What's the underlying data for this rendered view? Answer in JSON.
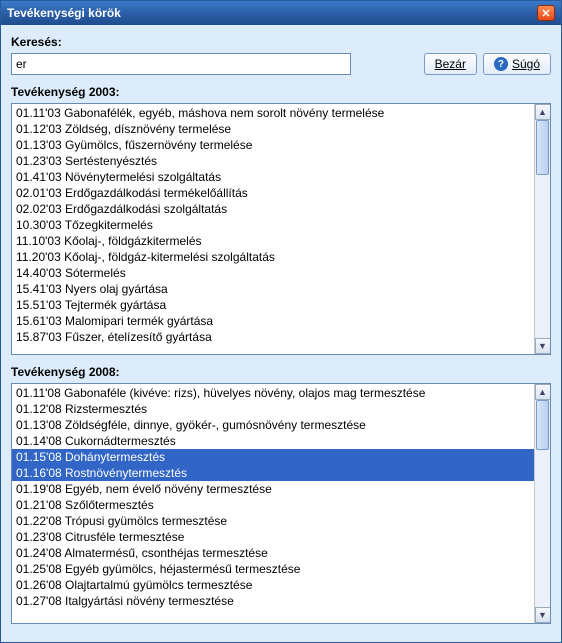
{
  "title": "Tevékenységi körök",
  "search": {
    "label": "Keresés:",
    "value": "er"
  },
  "buttons": {
    "close": "Bezár",
    "help": "Súgó"
  },
  "section2003": {
    "label": "Tevékenység 2003:",
    "items": [
      {
        "code": "01.11'03",
        "text": "Gabonafélék, egyéb, máshova nem sorolt növény termelése"
      },
      {
        "code": "01.12'03",
        "text": "Zöldség, dísznövény termelése"
      },
      {
        "code": "01.13'03",
        "text": "Gyümölcs, fűszernövény termelése"
      },
      {
        "code": "01.23'03",
        "text": "Sertéstenyésztés"
      },
      {
        "code": "01.41'03",
        "text": "Növénytermelési szolgáltatás"
      },
      {
        "code": "02.01'03",
        "text": "Erdőgazdálkodási termékelőállítás"
      },
      {
        "code": "02.02'03",
        "text": "Erdőgazdálkodási szolgáltatás"
      },
      {
        "code": "10.30'03",
        "text": "Tőzegkitermelés"
      },
      {
        "code": "11.10'03",
        "text": "Kőolaj-, földgázkitermelés"
      },
      {
        "code": "11.20'03",
        "text": "Kőolaj-, földgáz-kitermelési szolgáltatás"
      },
      {
        "code": "14.40'03",
        "text": "Sótermelés"
      },
      {
        "code": "15.41'03",
        "text": "Nyers olaj gyártása"
      },
      {
        "code": "15.51'03",
        "text": "Tejtermék gyártása"
      },
      {
        "code": "15.61'03",
        "text": "Malomipari termék gyártása"
      },
      {
        "code": "15.87'03",
        "text": "Fűszer, ételízesítő gyártása"
      }
    ]
  },
  "section2008": {
    "label": "Tevékenység 2008:",
    "items": [
      {
        "code": "01.11'08",
        "text": "Gabonaféle (kivéve: rizs), hüvelyes növény, olajos mag termesztése"
      },
      {
        "code": "01.12'08",
        "text": "Rizstermesztés"
      },
      {
        "code": "01.13'08",
        "text": "Zöldségféle, dinnye, gyökér-, gumósnövény termesztése"
      },
      {
        "code": "01.14'08",
        "text": "Cukornádtermesztés"
      },
      {
        "code": "01.15'08",
        "text": "Dohánytermesztés",
        "selected": true
      },
      {
        "code": "01.16'08",
        "text": "Rostnövénytermesztés",
        "selected": true
      },
      {
        "code": "01.19'08",
        "text": "Egyéb, nem évelő növény termesztése"
      },
      {
        "code": "01.21'08",
        "text": "Szőlőtermesztés"
      },
      {
        "code": "01.22'08",
        "text": "Trópusi gyümölcs termesztése"
      },
      {
        "code": "01.23'08",
        "text": "Citrusféle termesztése"
      },
      {
        "code": "01.24'08",
        "text": "Almatermésű, csonthéjas termesztése"
      },
      {
        "code": "01.25'08",
        "text": "Egyéb gyümölcs, héjastermésű termesztése"
      },
      {
        "code": "01.26'08",
        "text": "Olajtartalmú gyümölcs termesztése"
      },
      {
        "code": "01.27'08",
        "text": "Italgyártási növény termesztése"
      }
    ]
  }
}
